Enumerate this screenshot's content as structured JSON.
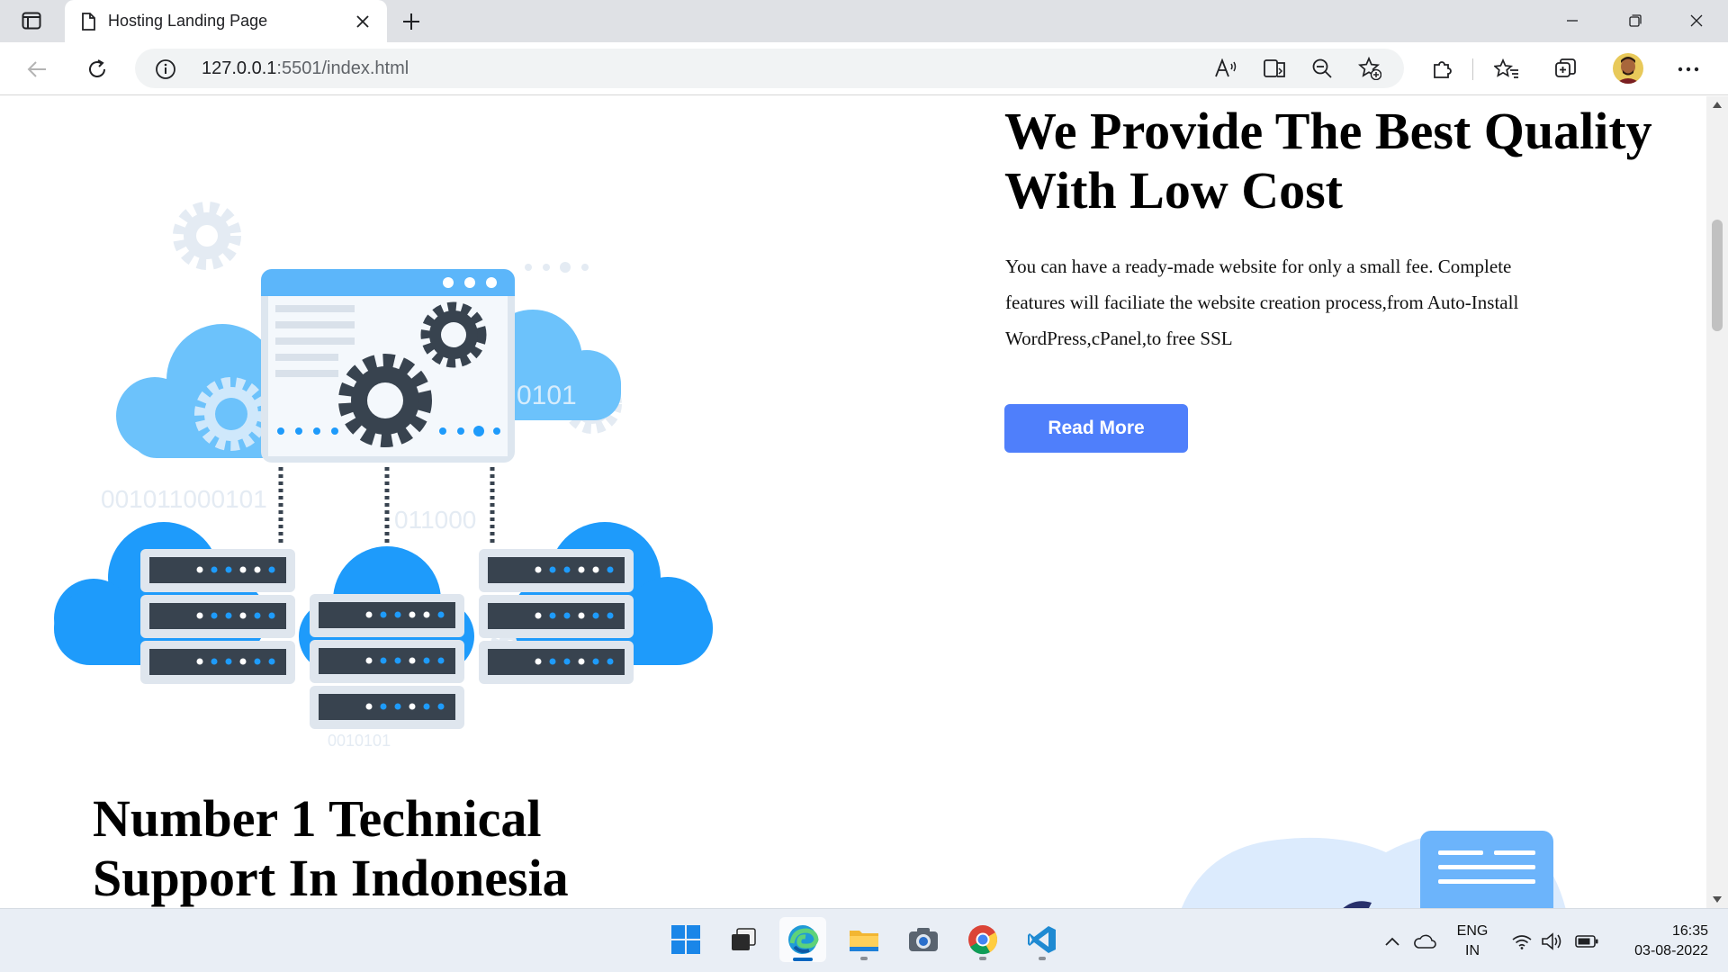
{
  "browser": {
    "tab_title": "Hosting Landing Page",
    "url_host": "127.0.0.1",
    "url_rest": ":5501/index.html"
  },
  "page": {
    "hero": {
      "title": "We Provide The Best Quality With Low Cost",
      "text": "You can have a ready-made website for only a small fee. Complete features will faciliate the website creation process,from Auto-Install WordPress,cPanel,to free SSL",
      "button": "Read More"
    },
    "illustration": {
      "binary_1": "0101",
      "binary_2": "001011000101",
      "binary_3": "011000",
      "binary_4": "0010101"
    },
    "support": {
      "title": "Number 1 Technical Support In Indonesia"
    }
  },
  "taskbar": {
    "lang_1": "ENG",
    "lang_2": "IN",
    "time": "16:35",
    "date": "03-08-2022"
  },
  "colors": {
    "accent": "#4f7ffb",
    "cloud_dark": "#1e9bfb",
    "cloud_light": "#6cc2fb",
    "server": "#38434f"
  }
}
